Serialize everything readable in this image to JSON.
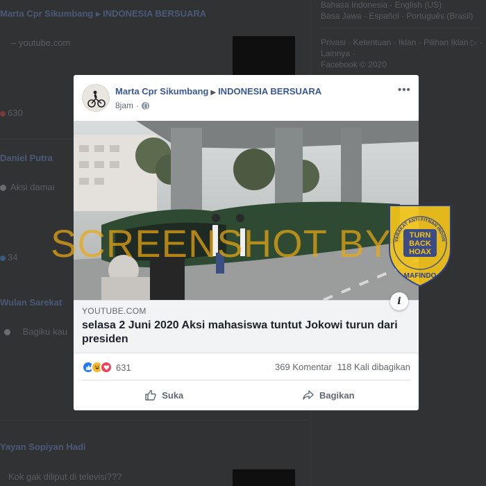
{
  "background": {
    "post1": {
      "author": "Marta Cpr Sikumbang",
      "group": "INDONESIA BERSUARA",
      "snippet": "– youtube.com",
      "reactions": "630"
    },
    "comment1": {
      "author": "Daniel Putra",
      "text": "Aksi damai",
      "count": "34"
    },
    "comment2": {
      "author": "Wulan Sarekat",
      "text": "Bagiku kau"
    },
    "comment3": {
      "author": "Yayan Sopiyan Hadi",
      "text": "Kok gak diliput di televisi???"
    },
    "sidebar": {
      "languages_line1": "Bahasa Indonesia · English (US)",
      "languages_line2": "Basa Jawa · Español · Português (Brasil)",
      "links_line1": "Privasi · Ketentuan · Iklan · Pilihan Iklan ▷ ·",
      "links_line2": "Lainnya ·",
      "copyright": "Facebook © 2020"
    }
  },
  "post": {
    "author": "Marta Cpr Sikumbang",
    "group": "INDONESIA BERSUARA",
    "time": "8jam",
    "link": {
      "domain": "YOUTUBE.COM",
      "title": "selasa 2 Juni 2020 Aksi mahasiswa tuntut Jokowi turun dari presiden"
    },
    "reactions_count": "631",
    "comments": "369 Komentar",
    "shares": "118 Kali dibagikan",
    "like_label": "Suka",
    "share_label": "Bagikan"
  },
  "watermark": {
    "text": "SCREENSHOT BY",
    "badge_top": "MASYARAKAT ANTI FITNAH INDONESIA",
    "badge_center": [
      "TURN",
      "BACK",
      "HOAX"
    ],
    "badge_bottom": "MAFINDO"
  },
  "colors": {
    "link_blue": "#385898",
    "watermark_orange": "#eaa814",
    "badge_yellow": "#f2c41a",
    "badge_blue": "#2a3f8f"
  }
}
